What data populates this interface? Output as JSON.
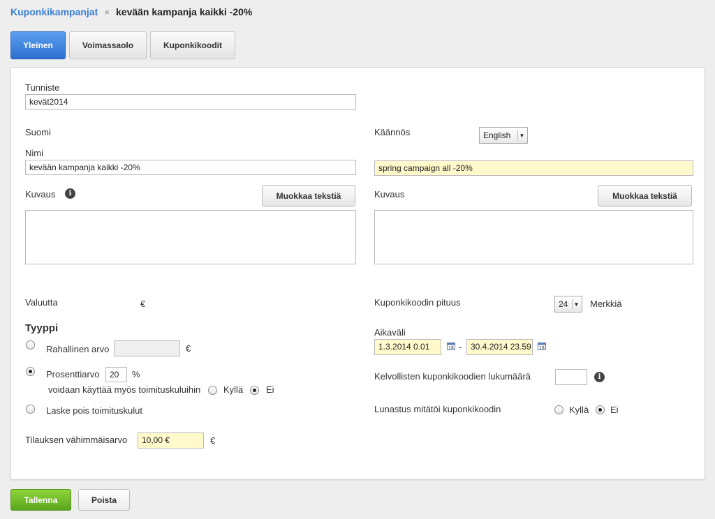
{
  "breadcrumb": {
    "parent": "Kuponkikampanjat",
    "separator": "«",
    "current": "kevään kampanja kaikki -20%"
  },
  "tabs": [
    {
      "label": "Yleinen",
      "active": true
    },
    {
      "label": "Voimassaolo",
      "active": false
    },
    {
      "label": "Kuponkikoodit",
      "active": false
    }
  ],
  "form": {
    "identifier_label": "Tunniste",
    "identifier_value": "kevät2014",
    "source_lang_label": "Suomi",
    "translation_label": "Käännös",
    "translation_lang": "English",
    "name_label": "Nimi",
    "name_value": "kevään kampanja kaikki -20%",
    "name_translation": "spring campaign all -20%",
    "description_label": "Kuvaus",
    "description_translation_label": "Kuvaus",
    "edit_text_button": "Muokkaa tekstiä",
    "edit_text_button_translation": "Muokkaa tekstiä",
    "currency_label": "Valuutta",
    "currency_value": "€",
    "type_heading": "Tyyppi",
    "monetary_label": "Rahallinen arvo",
    "monetary_unit": "€",
    "percentage_label": "Prosenttiarvo",
    "percentage_value": "20",
    "percentage_unit": "%",
    "shipping_usable_label": "voidaan käyttää myös toimituskuluihin",
    "yes_label": "Kyllä",
    "no_label": "Ei",
    "deduct_shipping_label": "Laske pois toimituskulut",
    "min_order_label": "Tilauksen vähimmäisarvo",
    "min_order_value": "10,00 €",
    "min_order_unit": "€",
    "code_length_label": "Kuponkikoodin pituus",
    "code_length_value": "24",
    "code_length_unit": "Merkkiä",
    "interval_label": "Aikaväli",
    "interval_start": "1.3.2014 0.01",
    "interval_dash": "-",
    "interval_end": "30.4.2014 23.59",
    "valid_codes_label": "Kelvollisten kuponkikoodien lukumäärä",
    "valid_codes_value": "",
    "redeem_label": "Lunastus mitätöi kuponkikoodin",
    "redeem_yes": "Kyllä",
    "redeem_no": "Ei"
  },
  "footer": {
    "save": "Tallenna",
    "delete": "Poista"
  },
  "icons": {
    "info": "info-icon",
    "calendar": "calendar-icon"
  },
  "colors": {
    "accent": "#3a7fd5",
    "save": "#6ab82a",
    "highlight_input": "#fff9cc"
  }
}
